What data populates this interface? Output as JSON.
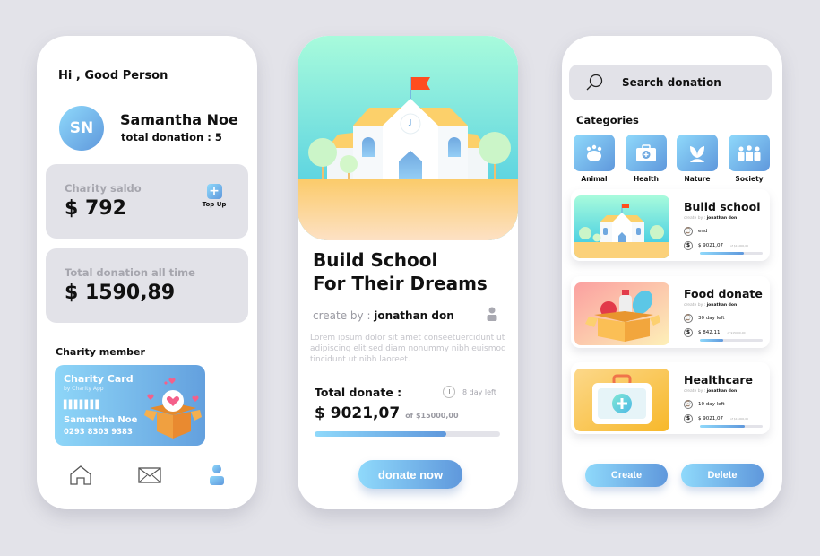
{
  "profile_screen": {
    "greeting": "Hi , Good Person",
    "avatar_initials": "SN",
    "user_name": "Samantha Noe",
    "total_donation": "total donation : 5",
    "charity_saldo": {
      "label": "Charity saldo",
      "amount": "$ 792",
      "topup_label": "Top Up"
    },
    "total_all_time": {
      "label": "Total donation all time",
      "amount": "$ 1590,89"
    },
    "member_title": "Charity member",
    "card": {
      "title": "Charity Card",
      "subtitle": "by Charity App",
      "barcode": "▌▌▌▌▌▌▌",
      "holder": "Samantha Noe",
      "number": "0293 8303 9383"
    },
    "nav": [
      {
        "icon": "home-icon",
        "active": false
      },
      {
        "icon": "mail-icon",
        "active": false
      },
      {
        "icon": "user-icon",
        "active": true
      }
    ]
  },
  "detail_screen": {
    "title_line1": "Build School",
    "title_line2": "For Their Dreams",
    "created_by_label": "create by : ",
    "creator": "jonathan don",
    "description": "Lorem ipsum dolor sit amet conseetuercidunt ut adipiscing elit sed diam nonummy nibh euismod tincidunt ut nibh laoreet.",
    "total_label": "Total donate :",
    "amount": "$ 9021,07",
    "goal": "of $15000,00",
    "days_left": "8 day left",
    "progress_percent": 71,
    "donate_button": "donate now"
  },
  "list_screen": {
    "search_placeholder": "Search donation",
    "categories_title": "Categories",
    "categories": [
      {
        "label": "Animal",
        "icon": "paw-icon"
      },
      {
        "label": "Health",
        "icon": "medkit-icon"
      },
      {
        "label": "Nature",
        "icon": "plant-icon"
      },
      {
        "label": "Society",
        "icon": "people-icon"
      }
    ],
    "items": [
      {
        "title": "Build school",
        "created_by": "create by : ",
        "creator": "jonathan don",
        "status": "end",
        "amount": "$ 9021,07",
        "goal": "of $15000,00",
        "progress_percent": 70
      },
      {
        "title": "Food donate",
        "created_by": "create by : ",
        "creator": "jonathan don",
        "status": "30 day left",
        "amount": "$ 842,11",
        "goal": "of $15000,00",
        "progress_percent": 37
      },
      {
        "title": "Healthcare",
        "created_by": "create by : ",
        "creator": "jonathan don",
        "status": "10 day left",
        "amount": "$ 9021,07",
        "goal": "of $15000,00",
        "progress_percent": 71
      }
    ],
    "create_button": "Create",
    "delete_button": "Delete"
  },
  "colors": {
    "accent_start": "#8fd9fb",
    "accent_end": "#5f98dc",
    "panel": "#e2e2e8",
    "background": "#e3e3e9"
  }
}
